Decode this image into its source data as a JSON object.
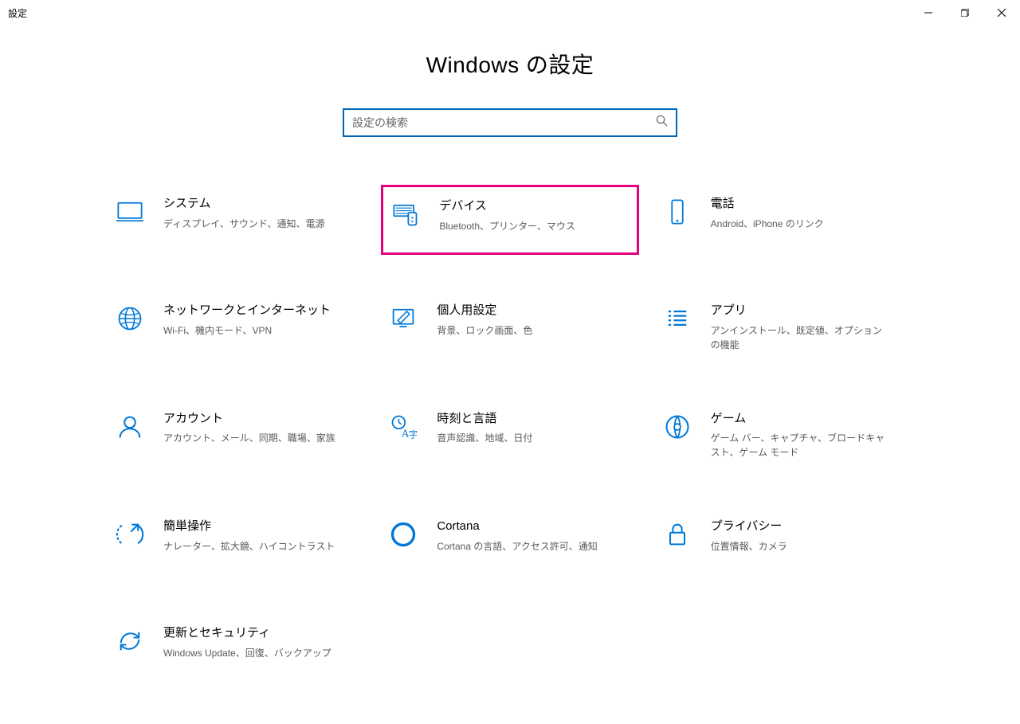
{
  "window": {
    "title": "設定"
  },
  "header": {
    "heading": "Windows の設定"
  },
  "search": {
    "placeholder": "設定の検索"
  },
  "cards": {
    "system": {
      "title": "システム",
      "desc": "ディスプレイ、サウンド、通知、電源"
    },
    "devices": {
      "title": "デバイス",
      "desc": "Bluetooth、プリンター、マウス"
    },
    "phone": {
      "title": "電話",
      "desc": "Android、iPhone のリンク"
    },
    "network": {
      "title": "ネットワークとインターネット",
      "desc": "Wi-Fi、機内モード、VPN"
    },
    "personal": {
      "title": "個人用設定",
      "desc": "背景、ロック画面、色"
    },
    "apps": {
      "title": "アプリ",
      "desc": "アンインストール、既定値、オプションの機能"
    },
    "accounts": {
      "title": "アカウント",
      "desc": "アカウント、メール、同期、職場、家族"
    },
    "time": {
      "title": "時刻と言語",
      "desc": "音声認識、地域、日付"
    },
    "gaming": {
      "title": "ゲーム",
      "desc": "ゲーム バー、キャプチャ、ブロードキャスト、ゲーム モード"
    },
    "ease": {
      "title": "簡単操作",
      "desc": "ナレーター、拡大鏡、ハイコントラスト"
    },
    "cortana": {
      "title": "Cortana",
      "desc": "Cortana の言語、アクセス許可、通知"
    },
    "privacy": {
      "title": "プライバシー",
      "desc": "位置情報、カメラ"
    },
    "update": {
      "title": "更新とセキュリティ",
      "desc": "Windows Update、回復、バックアップ"
    }
  }
}
